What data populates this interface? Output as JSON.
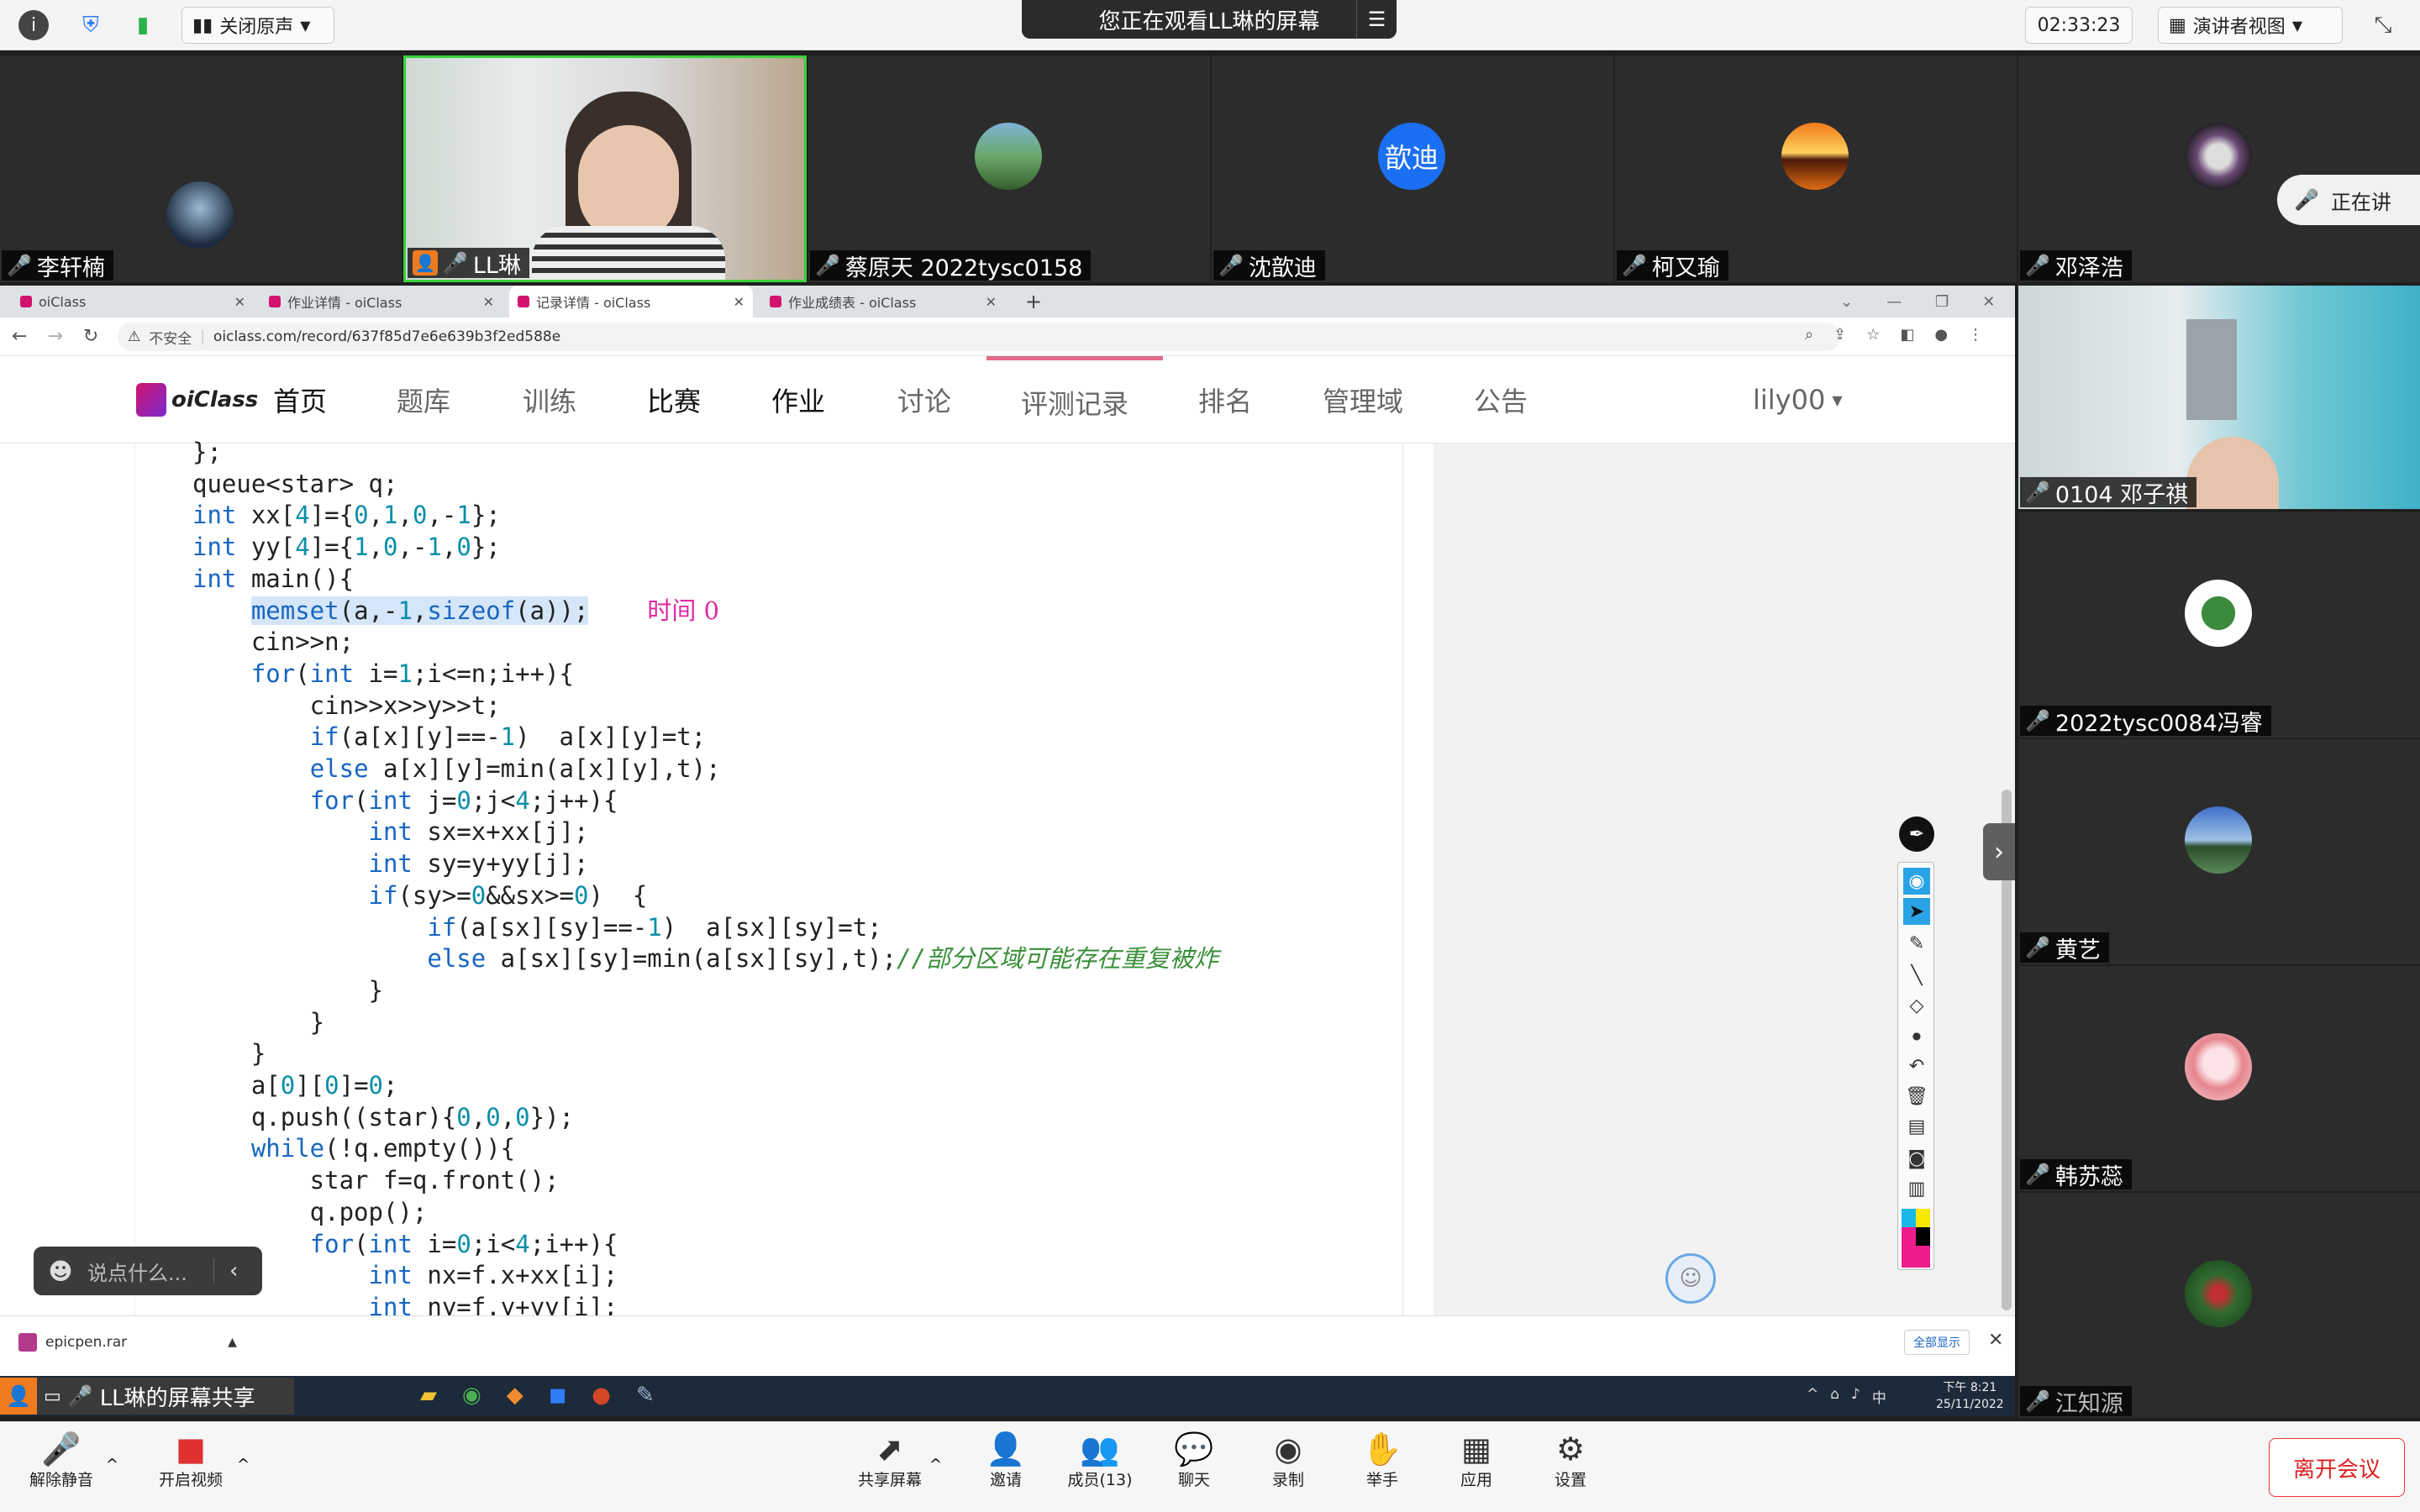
{
  "topbar": {
    "info_icon": "info-icon",
    "shield_icon": "shield-icon",
    "signal_icon": "signal-icon",
    "audio_label": "关闭原声",
    "watching_banner": "您正在观看LL琳的屏幕",
    "timer": "02:33:23",
    "view_label": "演讲者视图"
  },
  "participants_top": [
    {
      "name": "李轩楠"
    },
    {
      "name": "LL琳"
    },
    {
      "name": "蔡原天 2022tysc0158"
    },
    {
      "name": "沈歆迪",
      "avatar_text": "歆迪"
    },
    {
      "name": "柯又瑜"
    },
    {
      "name": "邓泽浩"
    }
  ],
  "speaking_badge": "正在讲",
  "participants_side": [
    {
      "name": "0104 邓子祺"
    },
    {
      "name": "2022tysc0084冯睿"
    },
    {
      "name": "黄艺"
    },
    {
      "name": "韩苏蕊"
    },
    {
      "name": "江知源"
    }
  ],
  "browser": {
    "tabs": [
      {
        "label": "oiClass"
      },
      {
        "label": "作业详情 - oiClass"
      },
      {
        "label": "记录详情 - oiClass"
      },
      {
        "label": "作业成绩表 - oiClass"
      }
    ],
    "new_tab": "+",
    "insecure_label": "不安全",
    "url": "oiclass.com/record/637f85d7e6e639b3f2ed588e"
  },
  "site_nav": {
    "logo": "oiClass",
    "items": [
      "首页",
      "题库",
      "训练",
      "比赛",
      "作业",
      "讨论",
      "评测记录",
      "排名",
      "管理域",
      "公告"
    ],
    "user": "lily00"
  },
  "code_lines": [
    "};",
    "queue<star> q;",
    "int xx[4]={0,1,0,-1};",
    "int yy[4]={1,0,-1,0};",
    "int main(){",
    "    memset(a,-1,sizeof(a));",
    "    cin>>n;",
    "    for(int i=1;i<=n;i++){",
    "        cin>>x>>y>>t;",
    "        if(a[x][y]==-1)  a[x][y]=t;",
    "        else a[x][y]=min(a[x][y],t);",
    "        for(int j=0;j<4;j++){",
    "            int sx=x+xx[j];",
    "            int sy=y+yy[j];",
    "            if(sy>=0&&sx>=0)  {",
    "                if(a[sx][sy]==-1)  a[sx][sy]=t;",
    "                else a[sx][sy]=min(a[sx][sy],t);//部分区域可能存在重复被炸",
    "            }",
    "        }",
    "    }",
    "    a[0][0]=0;",
    "    q.push((star){0,0,0});",
    "    while(!q.empty()){",
    "        star f=q.front();",
    "        q.pop();",
    "        for(int i=0;i<4;i++){",
    "            int nx=f.x+xx[i];",
    "            int ny=f.y+yy[i];"
  ],
  "handwriting": "时间 0",
  "chat_placeholder": "说点什么...",
  "download": {
    "file": "epicpen.rar",
    "show_all": "全部显示"
  },
  "taskbar": {
    "time": "下午 8:21",
    "date": "25/11/2022",
    "ime": "中"
  },
  "share_label": "LL琳的屏幕共享",
  "bottom_bar": {
    "unmute": "解除静音",
    "start_video": "开启视频",
    "share_screen": "共享屏幕",
    "invite": "邀请",
    "members": "成员(13)",
    "chat": "聊天",
    "record": "录制",
    "raise_hand": "举手",
    "apps": "应用",
    "settings": "设置",
    "leave": "离开会议"
  },
  "colors": {
    "accent_pink": "#d2136d",
    "mic_off": "#e03030",
    "mic_on": "#37c837",
    "leave": "#e02020"
  }
}
